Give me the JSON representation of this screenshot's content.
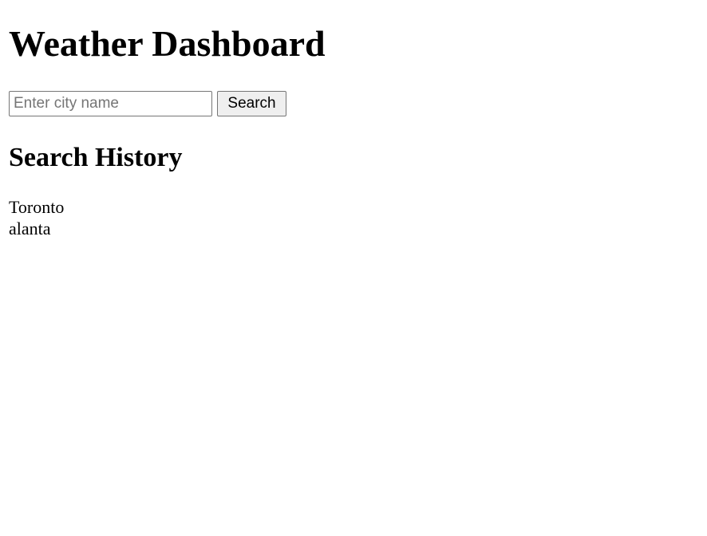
{
  "header": {
    "title": "Weather Dashboard"
  },
  "search": {
    "placeholder": "Enter city name",
    "value": "",
    "button_label": "Search"
  },
  "history": {
    "title": "Search History",
    "items": [
      {
        "label": "Toronto"
      },
      {
        "label": "alanta"
      }
    ]
  }
}
